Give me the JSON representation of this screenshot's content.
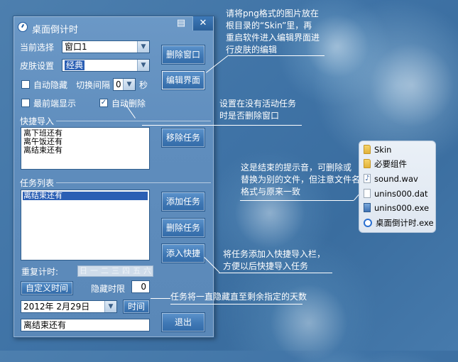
{
  "window": {
    "title": "桌面倒计时",
    "min_glyph": "▤",
    "close_glyph": "✕",
    "current_select_label": "当前选择",
    "current_select_value": "窗口1",
    "skin_label": "皮肤设置",
    "skin_value": "经典",
    "auto_hide_label": "自动隐藏",
    "switch_interval_label": "切换间隔",
    "switch_interval_value": "0",
    "seconds_unit": "秒",
    "topmost_label": "最前端显示",
    "auto_delete_label": "自动删除",
    "auto_hide_checked": false,
    "topmost_checked": false,
    "auto_delete_checked": true,
    "delete_window_button": "删除窗口",
    "edit_ui_button": "编辑界面",
    "quick_import_group": "快捷导入",
    "quick_import_items": [
      "离下班还有",
      "离午饭还有",
      "离结束还有"
    ],
    "remove_task_button": "移除任务",
    "task_list_group": "任务列表",
    "task_list_items": [
      "离结束还有"
    ],
    "add_task_button": "添加任务",
    "delete_task_button": "删除任务",
    "add_quick_button": "添入快捷",
    "repeat_label": "重复计时:",
    "weekdays": [
      "日",
      "一",
      "二",
      "三",
      "四",
      "五",
      "六"
    ],
    "custom_time_button": "自定义时间",
    "hide_limit_label": "隐藏时限",
    "hide_limit_value": "0",
    "date_value": "2012年 2月29日",
    "time_button": "时间",
    "task_name_value": "离结束还有",
    "exit_button": "退出",
    "colors": {
      "window_bg": "#5f8dbd",
      "button": "#3f78b5",
      "selection": "#2b5fb4"
    }
  },
  "annotations": {
    "skin": [
      "请将png格式的图片放在",
      "根目录的“Skin”里，再",
      "重启软件进入编辑界面进",
      "行皮肤的编辑"
    ],
    "auto_delete": [
      "设置在没有活动任务",
      "时是否删除窗口"
    ],
    "sound": [
      "这是结束的提示音，可删除或",
      "替换为别的文件，但注意文件名",
      "格式与原来一致"
    ],
    "add_quick": [
      "将任务添加入快捷导入栏，",
      "方便以后快捷导入任务"
    ],
    "hide_limit": "任务将一直隐藏直至剩余指定的天数"
  },
  "files": [
    {
      "name": "Skin",
      "icon": "folder-icon"
    },
    {
      "name": "必要组件",
      "icon": "folder-icon"
    },
    {
      "name": "sound.wav",
      "icon": "audio-file-icon"
    },
    {
      "name": "unins000.dat",
      "icon": "file-icon"
    },
    {
      "name": "unins000.exe",
      "icon": "installer-icon"
    },
    {
      "name": "桌面倒计时.exe",
      "icon": "clock-app-icon"
    }
  ]
}
